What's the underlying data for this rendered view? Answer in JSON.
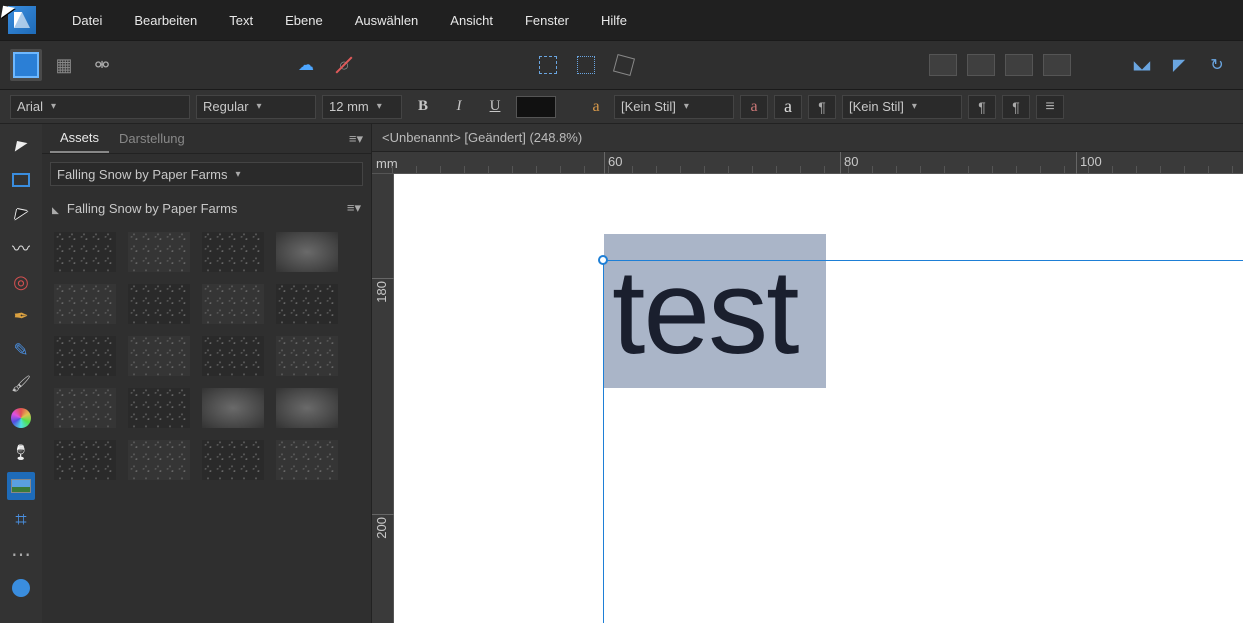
{
  "menubar": {
    "items": [
      "Datei",
      "Bearbeiten",
      "Text",
      "Ebene",
      "Auswählen",
      "Ansicht",
      "Fenster",
      "Hilfe"
    ]
  },
  "contextbar": {
    "font": "Arial",
    "weight": "Regular",
    "size": "12 mm",
    "bold": "B",
    "italic": "I",
    "underline": "U",
    "char_a": "a",
    "char_style_label": "[Kein Stil]",
    "para_a_small": "a",
    "para_a_big": "a",
    "para_style_label": "[Kein Stil]"
  },
  "panel": {
    "tabs": {
      "assets": "Assets",
      "appearance": "Darstellung"
    },
    "pack_dropdown": "Falling Snow by Paper Farms",
    "category": "Falling Snow by Paper Farms"
  },
  "document": {
    "title": "<Unbenannt> [Geändert] (248.8%)",
    "ruler_unit": "mm",
    "h_ticks": [
      "60",
      "80",
      "100"
    ],
    "v_ticks": [
      "180",
      "200"
    ],
    "canvas_text": "test"
  }
}
